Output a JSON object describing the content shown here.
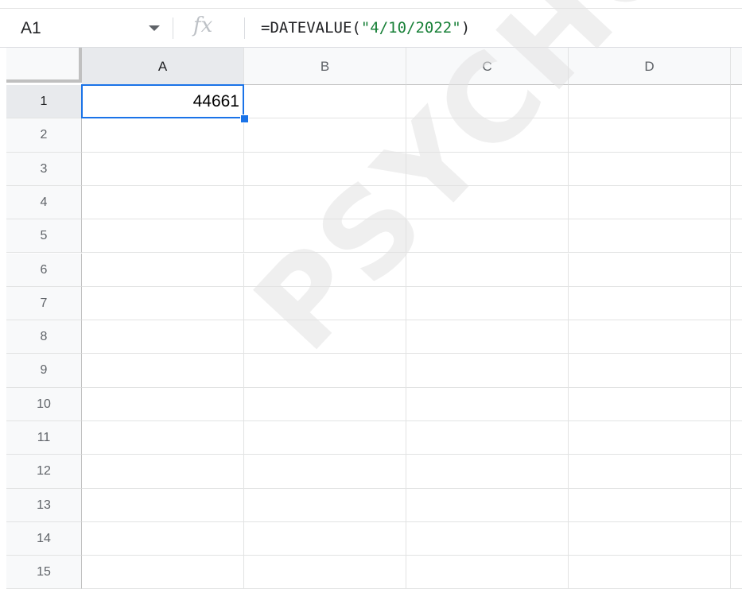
{
  "formula_bar": {
    "name_box": "A1",
    "fx_label": "fx",
    "formula_prefix": "=DATEVALUE(",
    "formula_string": "\"4/10/2022\"",
    "formula_suffix": ")"
  },
  "columns": [
    "A",
    "B",
    "C",
    "D"
  ],
  "rows": [
    "1",
    "2",
    "3",
    "4",
    "5",
    "6",
    "7",
    "8",
    "9",
    "10",
    "11",
    "12",
    "13",
    "14",
    "15"
  ],
  "cells": {
    "A1": "44661"
  },
  "selection": "A1",
  "watermark": "PSYCHOLOGY",
  "colors": {
    "selection_blue": "#1a73e8",
    "formula_string_green": "#188038"
  }
}
